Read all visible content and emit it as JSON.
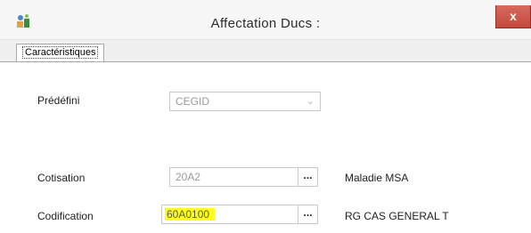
{
  "window": {
    "title": "Affectation Ducs :",
    "close_label": "x"
  },
  "tabs": [
    {
      "label": "Caractéristiques",
      "active": true
    }
  ],
  "form": {
    "predefini": {
      "label": "Prédéfini",
      "value": "CEGID"
    },
    "cotisation": {
      "label": "Cotisation",
      "value": "20A2",
      "button_label": "...",
      "description": "Maladie MSA"
    },
    "codification": {
      "label": "Codification",
      "value": "60A0100",
      "button_label": "...",
      "description": "RG CAS GENERAL T"
    }
  },
  "colors": {
    "highlight": "#ffff1a",
    "close_button": "#c8554a",
    "field_text": "#9a9a9a"
  }
}
